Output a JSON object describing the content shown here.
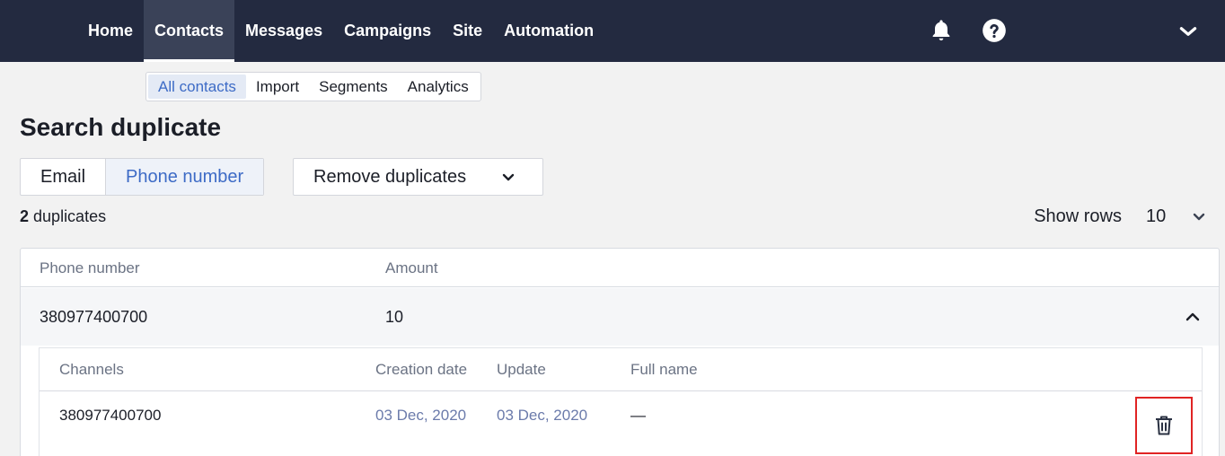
{
  "nav": {
    "items": [
      {
        "label": "Home"
      },
      {
        "label": "Contacts"
      },
      {
        "label": "Messages"
      },
      {
        "label": "Campaigns"
      },
      {
        "label": "Site"
      },
      {
        "label": "Automation"
      }
    ],
    "active": "Contacts"
  },
  "subnav": {
    "items": [
      {
        "label": "All contacts"
      },
      {
        "label": "Import"
      },
      {
        "label": "Segments"
      },
      {
        "label": "Analytics"
      }
    ],
    "active": "All contacts"
  },
  "page": {
    "title": "Search duplicate"
  },
  "toggle": {
    "email_label": "Email",
    "phone_label": "Phone number",
    "active": "Phone number"
  },
  "remove_duplicates_label": "Remove duplicates",
  "summary": {
    "count": "2",
    "suffix": "duplicates"
  },
  "show_rows": {
    "label": "Show rows",
    "value": "10"
  },
  "table": {
    "columns": [
      "Phone number",
      "Amount"
    ],
    "row": {
      "phone": "380977400700",
      "amount": "10"
    }
  },
  "subtable": {
    "columns": [
      "Channels",
      "Creation date",
      "Update",
      "Full name"
    ],
    "row": {
      "channel": "380977400700",
      "created": "03 Dec, 2020",
      "updated": "03 Dec, 2020",
      "full_name": "—"
    }
  },
  "colors": {
    "topbar": "#232a40",
    "accent": "#3d6bc6",
    "highlight_border": "#e02424"
  },
  "icons": {
    "bell": "bell-icon",
    "help": "help-icon",
    "menu_chevron": "chevron-down-icon",
    "expand": "chevron-up-icon",
    "delete": "trash-icon"
  }
}
